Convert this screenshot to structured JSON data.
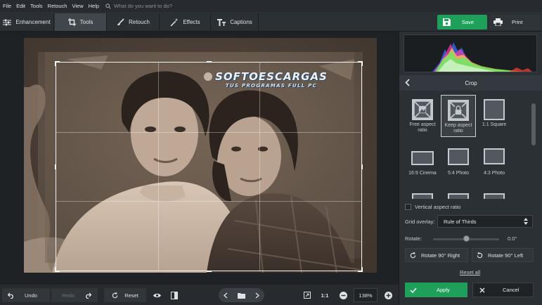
{
  "menu": {
    "items": [
      "File",
      "Edit",
      "Tools",
      "Retouch",
      "View",
      "Help"
    ],
    "search_placeholder": "What do you want to do?"
  },
  "tabs": [
    {
      "label": "Enhancement",
      "icon": "sliders-icon"
    },
    {
      "label": "Tools",
      "icon": "crop-icon",
      "active": true
    },
    {
      "label": "Retouch",
      "icon": "brush-icon"
    },
    {
      "label": "Effects",
      "icon": "magic-wand-icon"
    },
    {
      "label": "Captions",
      "icon": "text-icon"
    }
  ],
  "actions": {
    "save_label": "Save",
    "print_label": "Print"
  },
  "watermark": {
    "line1": "SOFTOESCARGAS",
    "line2": "TUS PROGRAMAS FULL PC"
  },
  "bottom": {
    "undo_label": "Undo",
    "redo_label": "Redo",
    "reset_label": "Reset",
    "ratio_label": "1:1",
    "zoom_value": "138%"
  },
  "panel": {
    "title": "Crop",
    "presets": [
      {
        "label": "Free aspect ratio",
        "icon": "free-ratio-icon"
      },
      {
        "label": "Keep aspect ratio",
        "icon": "lock-ratio-icon",
        "selected": true
      },
      {
        "label": "1:1 Square",
        "icon": "square-ratio-icon"
      },
      {
        "label": "16:9 Cinema",
        "icon": "cinema-ratio-icon"
      },
      {
        "label": "5:4 Photo",
        "icon": "photo-5-4-icon"
      },
      {
        "label": "4:3 Photo",
        "icon": "photo-4-3-icon"
      },
      {
        "label": "",
        "icon": "portrait-ratio-icon"
      },
      {
        "label": "",
        "icon": "portrait-ratio-icon"
      },
      {
        "label": "",
        "icon": "portrait-ratio-icon"
      }
    ],
    "vertical_label": "Vertical aspect ratio",
    "grid_label": "Grid overlay:",
    "grid_value": "Rule of Thirds",
    "rotate_label": "Rotate:",
    "rotate_value": "0.0°",
    "rotate_slider_fraction": 0.5,
    "rotate_right_label": "Rotate 90° Right",
    "rotate_left_label": "Rotate 90° Left",
    "reset_all_label": "Reset all",
    "apply_label": "Apply",
    "cancel_label": "Cancel"
  },
  "colors": {
    "accent": "#1fa05a",
    "background": "#1e2225",
    "panel": "#2b3034"
  }
}
